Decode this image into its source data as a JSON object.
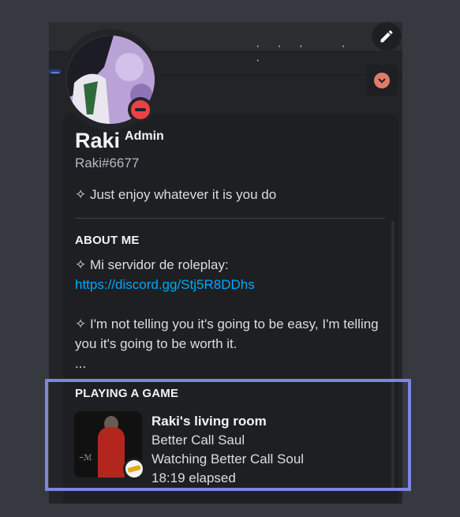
{
  "profile": {
    "display_name": "Raki",
    "role": "Admin",
    "tag": "Raki#6677",
    "custom_status": "✧ Just enjoy whatever it is you do",
    "status": "dnd"
  },
  "about": {
    "title": "ABOUT ME",
    "line1": "✧ Mi servidor de roleplay:",
    "link": "https://discord.gg/Stj5R8DDhs",
    "line2": "✧ I'm not telling you it's going to be easy, I'm telling you it's going to be worth it.",
    "more": "..."
  },
  "activity": {
    "title": "PLAYING A GAME",
    "name": "Raki's living room",
    "details": "Better Call Saul",
    "state": "Watching Better Call Soul",
    "elapsed": "18:19 elapsed"
  },
  "colors": {
    "background": "#36393f",
    "card": "#1e1f22",
    "link": "#00a8fc",
    "dnd": "#ed4245",
    "highlight": "#7c86e0"
  },
  "icons": {
    "edit": "pencil-icon",
    "dropdown": "chevron-down-icon",
    "status": "do-not-disturb-icon"
  }
}
